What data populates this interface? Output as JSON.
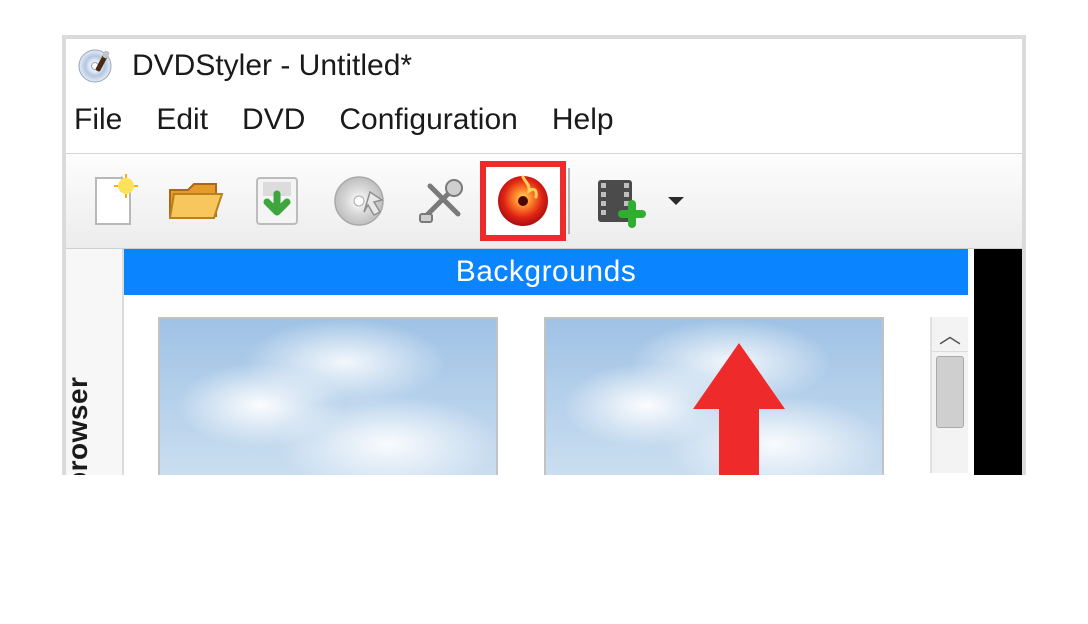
{
  "window": {
    "title": "DVDStyler - Untitled*"
  },
  "menu": {
    "file": "File",
    "edit": "Edit",
    "dvd": "DVD",
    "configuration": "Configuration",
    "help": "Help"
  },
  "toolbar": {
    "new": "New",
    "open": "Open",
    "save": "Save",
    "run": "Run",
    "settings": "Settings",
    "burn": "Burn",
    "add_file": "Add File",
    "highlighted_button": "burn"
  },
  "sidebar": {
    "tab_label": "browser"
  },
  "panel": {
    "header": "Backgrounds"
  },
  "annotation": {
    "arrow_color": "#ee2a2a",
    "highlight_color": "#ee2a2a"
  }
}
